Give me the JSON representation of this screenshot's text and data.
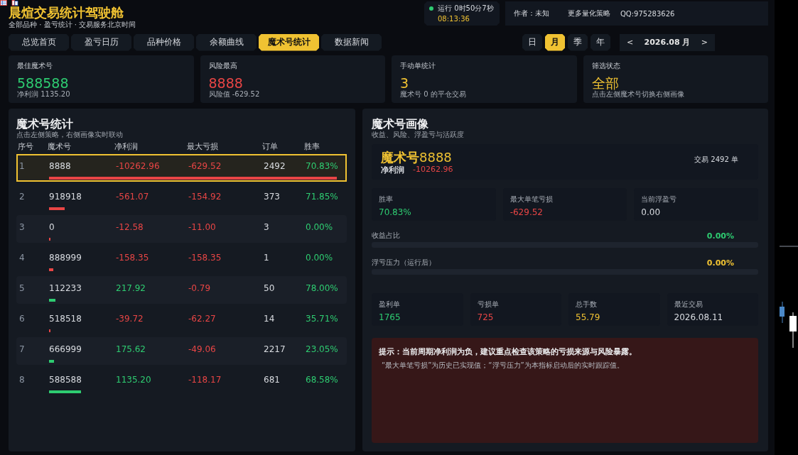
{
  "header": {
    "title": "晨煊交易统计驾驶舱",
    "subtitle": "全部品种 · 盈亏统计 · 交易服务北京时间"
  },
  "status": {
    "running": "运行 0时50分7秒",
    "time": "08:13:36",
    "online": true
  },
  "info": {
    "author": "作者：未知",
    "more": "更多量化策略",
    "qq": "QQ:975283626"
  },
  "tabs": [
    {
      "label": "总览首页",
      "selected": false
    },
    {
      "label": "盈亏日历",
      "selected": false
    },
    {
      "label": "品种价格",
      "selected": false
    },
    {
      "label": "余额曲线",
      "selected": false
    },
    {
      "label": "魔术号统计",
      "selected": true
    },
    {
      "label": "数据新闻",
      "selected": false
    }
  ],
  "periods": [
    {
      "label": "日",
      "selected": false
    },
    {
      "label": "月",
      "selected": true
    },
    {
      "label": "季",
      "selected": false
    },
    {
      "label": "年",
      "selected": false
    }
  ],
  "date_nav": {
    "prev": "<",
    "label": "2026.08 月",
    "next": ">"
  },
  "kpis": [
    {
      "title": "最佳魔术号",
      "value": "588588",
      "note": "净利润 1135.20",
      "kind": "gain"
    },
    {
      "title": "风险最高",
      "value": "8888",
      "note": "风险值 -629.52",
      "kind": "loss"
    },
    {
      "title": "手动单统计",
      "value": "3",
      "note": "魔术号 0 的平仓交易",
      "kind": "neutral"
    },
    {
      "title": "筛选状态",
      "value": "全部",
      "note": "点击左侧魔术号切换右侧画像",
      "kind": "neutral"
    }
  ],
  "magic_table": {
    "title": "魔术号统计",
    "subtitle": "点击左侧策略，右侧画像实时联动",
    "columns": [
      "序号",
      "魔术号",
      "净利润",
      "最大亏损",
      "订单",
      "胜率"
    ],
    "rows": [
      {
        "index": "1",
        "magic": "8888",
        "profit": "-10262.96",
        "max_loss": "-629.52",
        "orders": "2492",
        "win_rate": "70.83%",
        "selected": true,
        "color": "#e84545"
      },
      {
        "index": "2",
        "magic": "918918",
        "profit": "-561.07",
        "max_loss": "-154.92",
        "orders": "373",
        "win_rate": "71.85%",
        "selected": false,
        "color": "#e84545"
      },
      {
        "index": "3",
        "magic": "0",
        "profit": "-12.58",
        "max_loss": "-11.00",
        "orders": "3",
        "win_rate": "0.00%",
        "selected": false,
        "color": "#e84545"
      },
      {
        "index": "4",
        "magic": "888999",
        "profit": "-158.35",
        "max_loss": "-158.35",
        "orders": "1",
        "win_rate": "0.00%",
        "selected": false,
        "color": "#e84545"
      },
      {
        "index": "5",
        "magic": "112233",
        "profit": "217.92",
        "max_loss": "-0.79",
        "orders": "50",
        "win_rate": "78.00%",
        "selected": false,
        "color": "#2ecc71"
      },
      {
        "index": "6",
        "magic": "518518",
        "profit": "-39.72",
        "max_loss": "-62.27",
        "orders": "14",
        "win_rate": "35.71%",
        "selected": false,
        "color": "#e84545"
      },
      {
        "index": "7",
        "magic": "666999",
        "profit": "175.62",
        "max_loss": "-49.06",
        "orders": "2217",
        "win_rate": "23.05%",
        "selected": false,
        "color": "#2ecc71"
      },
      {
        "index": "8",
        "magic": "588588",
        "profit": "1135.20",
        "max_loss": "-118.17",
        "orders": "681",
        "win_rate": "68.58%",
        "selected": false,
        "color": "#2ecc71"
      }
    ]
  },
  "profile": {
    "title": "魔术号画像",
    "subtitle": "收益、风险、浮盈亏与活跃度",
    "magic": "**魔术号**8888",
    "profit_label": "净利润",
    "profit": "-10262.96",
    "trades": "交易 2492 单",
    "stats": [
      {
        "label": "胜率",
        "value": "70.83%",
        "color": "#2ecc71"
      },
      {
        "label": "最大单笔亏损",
        "value": "-629.52",
        "color": "#e84545"
      },
      {
        "label": "当前浮盈亏",
        "value": "0.00",
        "color": "#d8dbe0"
      }
    ],
    "meters": [
      {
        "label": "收益占比",
        "reading": "0.00%",
        "color": "#2ecc71"
      },
      {
        "label": "浮亏压力（运行后）",
        "reading": "0.00%",
        "color": "#f0c232"
      }
    ],
    "counts": [
      {
        "label": "盈利单",
        "value": "1765",
        "color": "#2ecc71"
      },
      {
        "label": "亏损单",
        "value": "725",
        "color": "#e84545"
      },
      {
        "label": "总手数",
        "value": "55.79",
        "color": "#f0c232"
      },
      {
        "label": "最近交易",
        "value": "2026.08.11",
        "color": "#d8dbe0"
      }
    ],
    "hint": {
      "title": "提示：当前周期净利润为负，建议重点检查该策略的亏损来源与风险暴露。",
      "text": "“最大单笔亏损”为历史已实现值；“浮亏压力”为本指标启动后的实时跟踪值。"
    }
  }
}
